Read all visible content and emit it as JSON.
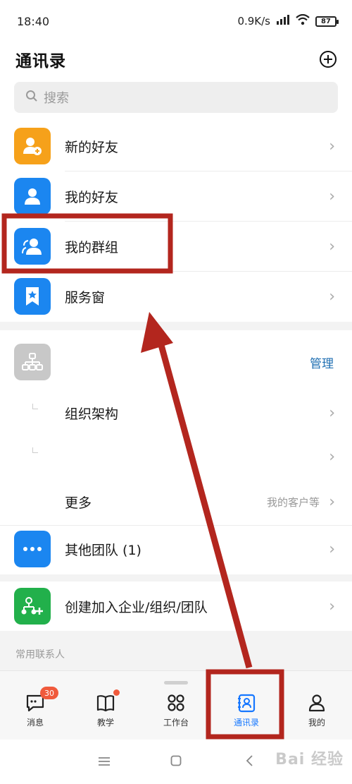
{
  "status_bar": {
    "time": "18:40",
    "speed": "0.9K/s",
    "battery": "87"
  },
  "header": {
    "title": "通讯录",
    "add_icon": "plus-circle-icon"
  },
  "search": {
    "placeholder": "搜索",
    "icon": "search-icon"
  },
  "contacts_menu": [
    {
      "label": "新的好友",
      "icon": "add-person-icon",
      "color": "#f6a11a"
    },
    {
      "label": "我的好友",
      "icon": "person-icon",
      "color": "#1b86f0"
    },
    {
      "label": "我的群组",
      "icon": "group-icon",
      "color": "#1b86f0"
    },
    {
      "label": "服务窗",
      "icon": "bookmark-star-icon",
      "color": "#1b86f0"
    }
  ],
  "organization": {
    "manage_label": "管理",
    "org_icon": "org-chart-icon",
    "org_tile_color": "#c8c8c8",
    "rows": [
      {
        "label": "组织架构"
      },
      {
        "label": ""
      },
      {
        "label": "更多",
        "sub": "我的客户等"
      }
    ]
  },
  "teams": {
    "other_teams_label": "其他团队 (1)",
    "other_teams_icon": "more-dots-icon",
    "other_teams_color": "#1b86f0",
    "create_label": "创建加入企业/组织/团队",
    "create_icon": "add-team-icon",
    "create_color": "#22b04b"
  },
  "frequent_contacts_label": "常用联系人",
  "bottom_nav": [
    {
      "label": "消息",
      "icon": "message-icon",
      "badge": "30"
    },
    {
      "label": "教学",
      "icon": "book-icon",
      "dot": true
    },
    {
      "label": "工作台",
      "icon": "grid-icon"
    },
    {
      "label": "通讯录",
      "icon": "contacts-icon",
      "active": true
    },
    {
      "label": "我的",
      "icon": "profile-icon"
    }
  ],
  "chevron": "›",
  "watermark": "Bai 经验",
  "accent_color": "#1677ff",
  "annotation_color": "#b3261e"
}
